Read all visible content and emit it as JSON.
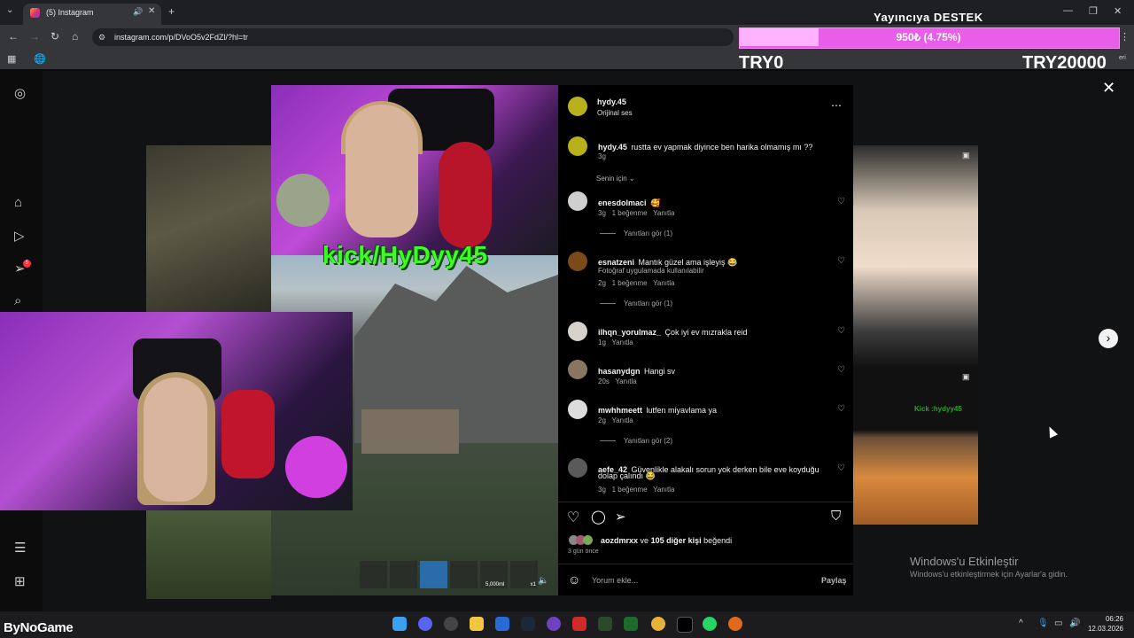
{
  "browser": {
    "tab_title": "(5) Instagram",
    "url": "instagram.com/p/DVoO5v2FdZl/?hl=tr",
    "bookmark_tail": "eri"
  },
  "donation": {
    "title": "Yayıncıya DESTEK",
    "amount": "950₺ (4.75%)",
    "progress_fraction": 0.0475,
    "min": "TRY0",
    "max": "TRY20000",
    "bar_color": "#e85ee8"
  },
  "overlay": {
    "kick_text": "kick/HyDyy45",
    "hotbar_amount": "5,000ml",
    "hotbar_count": "x1"
  },
  "thumbs": {
    "right_caption": "Kick :hydyy45"
  },
  "post": {
    "author": "hydy.45",
    "audio": "Orijinal ses",
    "caption_user": "hydy.45",
    "caption_text": "rustta ev yapmak diyince ben harika olmamış mı ??",
    "caption_time": "3g",
    "sort_label": "Senin için",
    "comments": [
      {
        "user": "enesdolmaci",
        "text": "🥰",
        "time": "3g",
        "likes": "1 beğenme",
        "reply": "Yanıtla",
        "view_replies": "Yanıtları gör (1)"
      },
      {
        "user": "esnatzeni",
        "text": "Mantık güzel ama işleyiş 😂",
        "text2": "Fotoğraf uygulamada kullanılabilir",
        "time": "2g",
        "likes": "1 beğenme",
        "reply": "Yanıtla",
        "view_replies": "Yanıtları gör (1)"
      },
      {
        "user": "ilhqn_yorulmaz_",
        "text": "Çok iyi ev mızrakla reid",
        "time": "1g",
        "reply": "Yanıtla"
      },
      {
        "user": "hasanydgn",
        "text": "Hangi sv",
        "time": "20s",
        "reply": "Yanıtla"
      },
      {
        "user": "mwhhmeett",
        "text": "lutfen miyavlama ya",
        "time": "2g",
        "reply": "Yanıtla",
        "view_replies": "Yanıtları gör (2)"
      },
      {
        "user": "aefe_42",
        "text": "Güvenlikle alakalı sorun yok derken bile eve koyduğu",
        "text2": "dolap çalındı 😂",
        "time": "3g",
        "likes": "1 beğenme",
        "reply": "Yanıtla"
      }
    ],
    "liked_by_user": "aozdmrxx",
    "liked_by_mid": "ve",
    "liked_by_others": "105 diğer kişi",
    "liked_by_suffix": "beğendi",
    "post_age": "3 gün önce",
    "comment_placeholder": "Yorum ekle...",
    "share_label": "Paylaş"
  },
  "sidebar": {
    "notif_count": "5"
  },
  "watermark": {
    "line1": "Windows'u Etkinleştir",
    "line2": "Windows'u etkinleştirmek için Ayarlar'a gidin."
  },
  "taskbar": {
    "brand": "ByNoGame",
    "time": "06:26",
    "date": "12.03.2026"
  },
  "icons": [
    "instagram-icon",
    "home-icon",
    "reels-icon",
    "send-icon",
    "search-icon",
    "menu-icon",
    "more-icon",
    "heart-icon",
    "comment-icon",
    "share-icon",
    "bookmark-icon",
    "emoji-icon",
    "close-icon",
    "chevron-right-icon"
  ]
}
